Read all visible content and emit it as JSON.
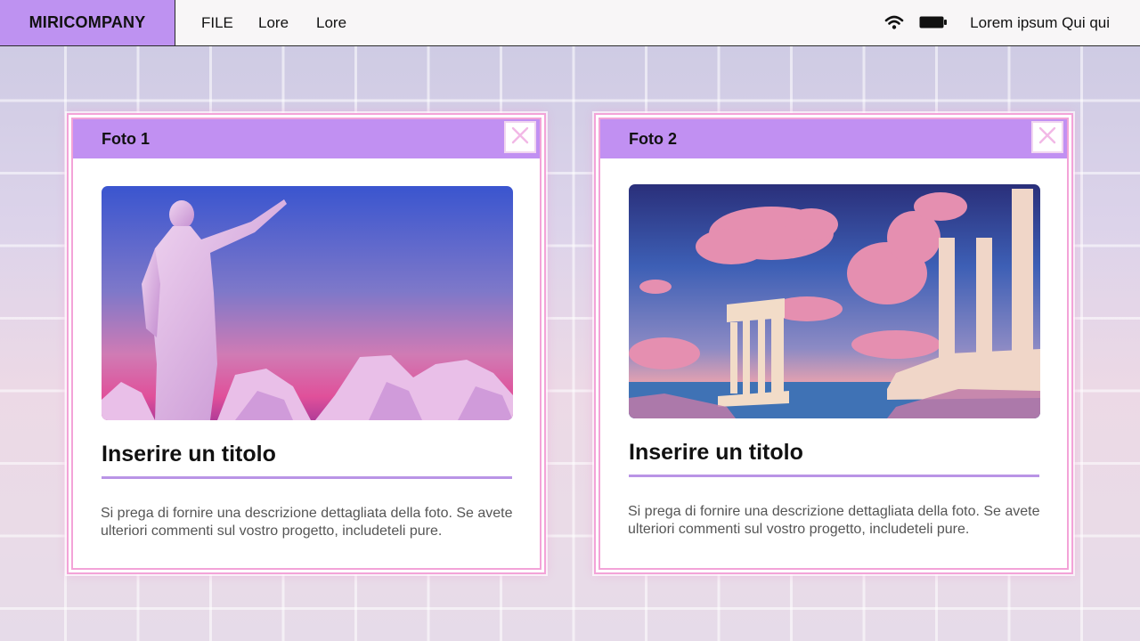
{
  "menubar": {
    "brand": "MIRICOMPANY",
    "items": [
      {
        "label": "FILE"
      },
      {
        "label": "Lore"
      },
      {
        "label": "Lore"
      }
    ],
    "status_text": "Lorem ipsum Qui qui",
    "icons": [
      "wifi-icon",
      "battery-icon"
    ]
  },
  "windows": [
    {
      "title": "Foto 1",
      "image": "statue-pointing-sunset",
      "card_title": "Inserire un titolo",
      "description": "Si prega di fornire una descrizione dettagliata della foto. Se avete ulteriori commenti sul vostro progetto, includeteli pure."
    },
    {
      "title": "Foto 2",
      "image": "greek-temple-ruins-clouds",
      "card_title": "Inserire un titolo",
      "description": "Si prega di fornire una descrizione dettagliata della foto. Se avete ulteriori commenti sul vostro progetto, includeteli pure."
    }
  ],
  "colors": {
    "accent_purple": "#c190f2",
    "window_border_pink": "#f3a3d8",
    "divider": "#b994e6"
  }
}
